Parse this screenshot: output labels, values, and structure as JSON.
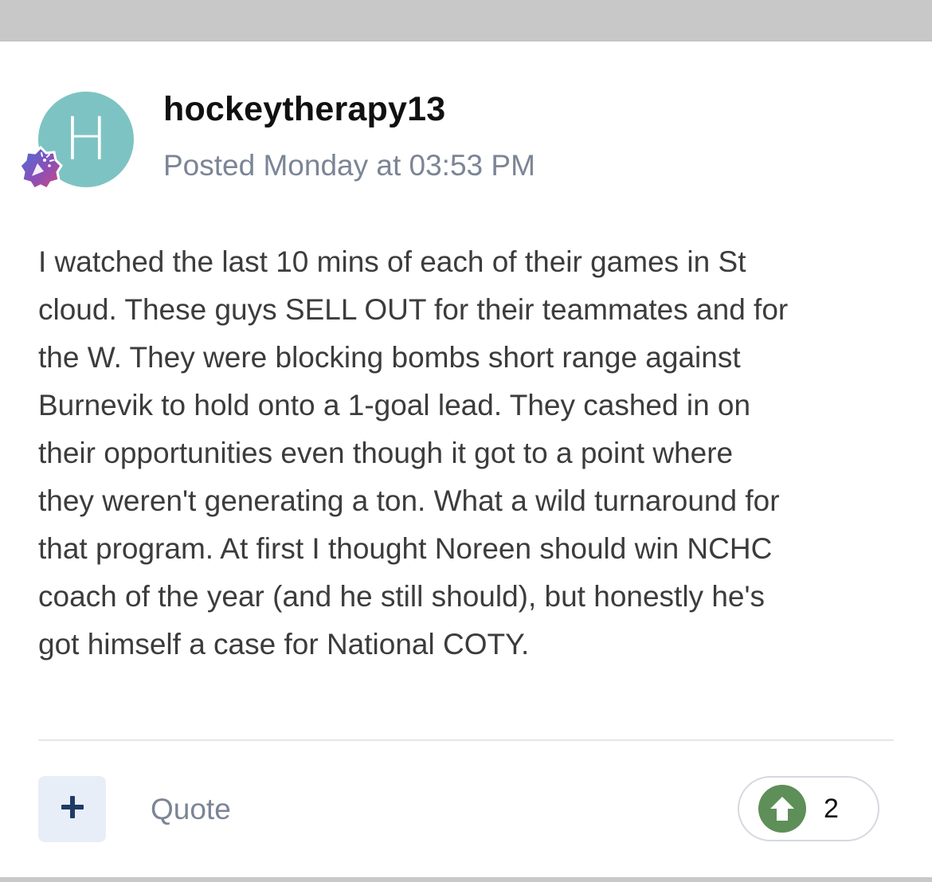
{
  "post": {
    "avatar_letter": "H",
    "avatar_color": "#7ec3c3",
    "badge_icon": "confetti-badge-icon",
    "username": "hockeytherapy13",
    "posted_text": "Posted Monday at 03:53 PM",
    "body": "I watched the last 10 mins of each of their games in St\ncloud. These guys SELL OUT for their teammates and for\nthe W. They were blocking bombs short range against\nBurnevik to hold onto a 1-goal lead. They cashed in on\ntheir opportunities even though it got to a point where\nthey weren't generating a ton. What a wild turnaround for\nthat program.  At first I thought Noreen should win NCHC\ncoach of the year (and he still should), but honestly he's\ngot himself a case for National COTY."
  },
  "actions": {
    "multiquote_icon": "plus-icon",
    "quote_label": "Quote",
    "reputation_icon": "upvote-arrow-icon",
    "reputation_count": "2",
    "reputation_color": "#5e8f58"
  }
}
